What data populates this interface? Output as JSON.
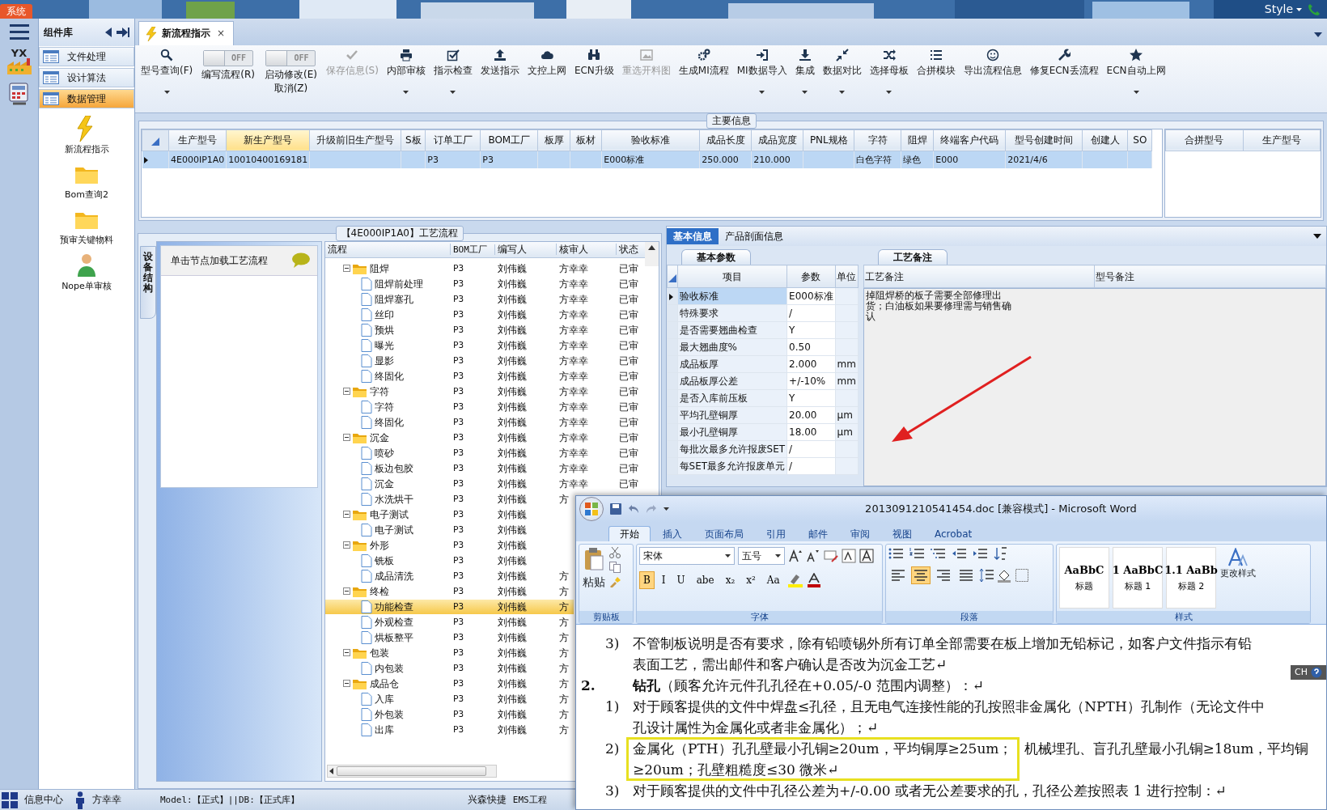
{
  "system_tab": "系统",
  "style_menu": "Style",
  "logo_text": "YX",
  "sidebar": {
    "title": "组件库",
    "categories": [
      {
        "label": "文件处理",
        "selected": false
      },
      {
        "label": "设计算法",
        "selected": false
      },
      {
        "label": "数据管理",
        "selected": true
      }
    ],
    "items": [
      {
        "label": "新流程指示"
      },
      {
        "label": "Bom查询2"
      },
      {
        "label": "预审关键物料"
      },
      {
        "label": "Nope单审核"
      }
    ]
  },
  "document_tab": {
    "label": "新流程指示",
    "close": "×"
  },
  "toolbar": [
    {
      "kind": "button",
      "label": "型号查询(F)",
      "disabled": false,
      "dropdown": true
    },
    {
      "kind": "toggle",
      "label": "编写流程(R)",
      "switch_text": "OFF",
      "on": false
    },
    {
      "kind": "toggle",
      "label": "启动修改(E)",
      "sublabel": "取消(Z)",
      "switch_text": "OFF",
      "on": false
    },
    {
      "kind": "button",
      "label": "保存信息(S)",
      "disabled": true,
      "dropdown": false
    },
    {
      "kind": "button",
      "label": "内部审核",
      "disabled": false,
      "dropdown": true
    },
    {
      "kind": "button",
      "label": "指示检查",
      "disabled": false,
      "dropdown": true
    },
    {
      "kind": "button",
      "label": "发送指示",
      "disabled": false,
      "dropdown": false
    },
    {
      "kind": "button",
      "label": "文控上网",
      "disabled": false,
      "dropdown": false
    },
    {
      "kind": "button",
      "label": "ECN升级",
      "disabled": false,
      "dropdown": false
    },
    {
      "kind": "button",
      "label": "重选开料图",
      "disabled": true,
      "dropdown": false
    },
    {
      "kind": "button",
      "label": "生成MI流程",
      "disabled": false,
      "dropdown": false
    },
    {
      "kind": "button",
      "label": "MI数据导入",
      "disabled": false,
      "dropdown": true
    },
    {
      "kind": "button",
      "label": "集成",
      "disabled": false,
      "dropdown": true
    },
    {
      "kind": "button",
      "label": "数据对比",
      "disabled": false,
      "dropdown": true
    },
    {
      "kind": "button",
      "label": "选择母板",
      "disabled": false,
      "dropdown": true
    },
    {
      "kind": "button",
      "label": "合拼模块",
      "disabled": false,
      "dropdown": false
    },
    {
      "kind": "button",
      "label": "导出流程信息",
      "disabled": false,
      "dropdown": false
    },
    {
      "kind": "button",
      "label": "修复ECN丢流程",
      "disabled": false,
      "dropdown": false
    },
    {
      "kind": "button",
      "label": "ECN自动上网",
      "disabled": false,
      "dropdown": true
    }
  ],
  "main_info": {
    "title": "主要信息",
    "columns": [
      {
        "label": "生产型号",
        "highlighted": false
      },
      {
        "label": "新生产型号",
        "highlighted": true
      },
      {
        "label": "升级前旧生产型号",
        "highlighted": false
      },
      {
        "label": "S板",
        "highlighted": false
      },
      {
        "label": "订单工厂",
        "highlighted": false
      },
      {
        "label": "BOM工厂",
        "highlighted": false
      },
      {
        "label": "板厚",
        "highlighted": false
      },
      {
        "label": "板材",
        "highlighted": false
      },
      {
        "label": "验收标准",
        "highlighted": false
      },
      {
        "label": "成品长度",
        "highlighted": false
      },
      {
        "label": "成品宽度",
        "highlighted": false
      },
      {
        "label": "PNL规格",
        "highlighted": false
      },
      {
        "label": "字符",
        "highlighted": false
      },
      {
        "label": "阻焊",
        "highlighted": false
      },
      {
        "label": "终端客户代码",
        "highlighted": false
      },
      {
        "label": "型号创建时间",
        "highlighted": false
      },
      {
        "label": "创建人",
        "highlighted": false
      },
      {
        "label": "SO",
        "highlighted": false
      }
    ],
    "rows": [
      {
        "selected": true,
        "cells": [
          "4E000IP1A0",
          "10010400169181",
          null,
          null,
          "P3",
          "P3",
          null,
          null,
          "E000标准",
          "250.000",
          "210.000",
          null,
          "白色字符",
          "绿色",
          "E000",
          "2021/4/6",
          null,
          null
        ]
      }
    ],
    "side_columns": [
      "合拼型号",
      "生产型号"
    ]
  },
  "process": {
    "title": "【4E000IP1A0】工艺流程",
    "side_tab": "设备结构",
    "hint": "单击节点加载工艺流程",
    "columns": [
      "流程",
      "BOM工厂",
      "编写人",
      "核审人",
      "状态"
    ],
    "tree": [
      {
        "name": "阻焊",
        "bom": "P3",
        "writer": "刘伟巍",
        "reviewer": "方幸幸",
        "status": "已审",
        "expanded": true,
        "selected": false,
        "children": [
          {
            "name": "阻焊前处理",
            "bom": "P3",
            "writer": "刘伟巍",
            "reviewer": "方幸幸",
            "status": "已审",
            "selected": false
          },
          {
            "name": "阻焊塞孔",
            "bom": "P3",
            "writer": "刘伟巍",
            "reviewer": "方幸幸",
            "status": "已审",
            "selected": false
          },
          {
            "name": "丝印",
            "bom": "P3",
            "writer": "刘伟巍",
            "reviewer": "方幸幸",
            "status": "已审",
            "selected": false
          },
          {
            "name": "预烘",
            "bom": "P3",
            "writer": "刘伟巍",
            "reviewer": "方幸幸",
            "status": "已审",
            "selected": false
          },
          {
            "name": "曝光",
            "bom": "P3",
            "writer": "刘伟巍",
            "reviewer": "方幸幸",
            "status": "已审",
            "selected": false
          },
          {
            "name": "显影",
            "bom": "P3",
            "writer": "刘伟巍",
            "reviewer": "方幸幸",
            "status": "已审",
            "selected": false
          },
          {
            "name": "终固化",
            "bom": "P3",
            "writer": "刘伟巍",
            "reviewer": "方幸幸",
            "status": "已审",
            "selected": false
          }
        ]
      },
      {
        "name": "字符",
        "bom": "P3",
        "writer": "刘伟巍",
        "reviewer": "方幸幸",
        "status": "已审",
        "expanded": true,
        "selected": false,
        "children": [
          {
            "name": "字符",
            "bom": "P3",
            "writer": "刘伟巍",
            "reviewer": "方幸幸",
            "status": "已审",
            "selected": false
          },
          {
            "name": "终固化",
            "bom": "P3",
            "writer": "刘伟巍",
            "reviewer": "方幸幸",
            "status": "已审",
            "selected": false
          }
        ]
      },
      {
        "name": "沉金",
        "bom": "P3",
        "writer": "刘伟巍",
        "reviewer": "方幸幸",
        "status": "已审",
        "expanded": true,
        "selected": false,
        "children": [
          {
            "name": "喷砂",
            "bom": "P3",
            "writer": "刘伟巍",
            "reviewer": "方幸幸",
            "status": "已审",
            "selected": false
          },
          {
            "name": "板边包胶",
            "bom": "P3",
            "writer": "刘伟巍",
            "reviewer": "方幸幸",
            "status": "已审",
            "selected": false
          },
          {
            "name": "沉金",
            "bom": "P3",
            "writer": "刘伟巍",
            "reviewer": "方幸幸",
            "status": "已审",
            "selected": false
          },
          {
            "name": "水洗烘干",
            "bom": "P3",
            "writer": "刘伟巍",
            "reviewer": "方",
            "selected": false
          }
        ]
      },
      {
        "name": "电子测试",
        "bom": "P3",
        "writer": "刘伟巍",
        "expanded": true,
        "selected": false,
        "children": [
          {
            "name": "电子测试",
            "bom": "P3",
            "writer": "刘伟巍",
            "selected": false
          }
        ]
      },
      {
        "name": "外形",
        "bom": "P3",
        "writer": "刘伟巍",
        "expanded": true,
        "selected": false,
        "children": [
          {
            "name": "铣板",
            "bom": "P3",
            "writer": "刘伟巍",
            "selected": false
          },
          {
            "name": "成品清洗",
            "bom": "P3",
            "writer": "刘伟巍",
            "reviewer": "方",
            "selected": false
          }
        ]
      },
      {
        "name": "终检",
        "bom": "P3",
        "writer": "刘伟巍",
        "reviewer": "方",
        "expanded": true,
        "selected": false,
        "children": [
          {
            "name": "功能检查",
            "bom": "P3",
            "writer": "刘伟巍",
            "reviewer": "方",
            "selected": true
          },
          {
            "name": "外观检查",
            "bom": "P3",
            "writer": "刘伟巍",
            "reviewer": "方",
            "selected": false
          },
          {
            "name": "烘板整平",
            "bom": "P3",
            "writer": "刘伟巍",
            "reviewer": "方",
            "selected": false
          }
        ]
      },
      {
        "name": "包装",
        "bom": "P3",
        "writer": "刘伟巍",
        "reviewer": "方",
        "expanded": true,
        "selected": false,
        "children": [
          {
            "name": "内包装",
            "bom": "P3",
            "writer": "刘伟巍",
            "reviewer": "方",
            "selected": false
          }
        ]
      },
      {
        "name": "成品仓",
        "bom": "P3",
        "writer": "刘伟巍",
        "reviewer": "方",
        "expanded": true,
        "selected": false,
        "children": [
          {
            "name": "入库",
            "bom": "P3",
            "writer": "刘伟巍",
            "reviewer": "方",
            "selected": false
          },
          {
            "name": "外包装",
            "bom": "P3",
            "writer": "刘伟巍",
            "reviewer": "方",
            "selected": false
          },
          {
            "name": "出库",
            "bom": "P3",
            "writer": "刘伟巍",
            "reviewer": "方",
            "selected": false
          }
        ]
      }
    ]
  },
  "info_panel": {
    "tabs": [
      {
        "label": "基本信息",
        "selected": true
      },
      {
        "label": "产品剖面信息",
        "selected": false
      }
    ],
    "params": {
      "tab": "基本参数",
      "columns": [
        "项目",
        "参数",
        "单位"
      ],
      "rows": [
        {
          "item": "验收标准",
          "value": "E000标准",
          "selected": true
        },
        {
          "item": "特殊要求",
          "value": "/",
          "selected": false
        },
        {
          "item": "是否需要翘曲检查",
          "value": "Y",
          "selected": false
        },
        {
          "item": "最大翘曲度%",
          "value": "0.50",
          "selected": false
        },
        {
          "item": "成品板厚",
          "value": "2.000",
          "unit": "mm",
          "selected": false
        },
        {
          "item": "成品板厚公差",
          "value": "+/-10%",
          "unit": "mm",
          "selected": false
        },
        {
          "item": "是否入库前压板",
          "value": "Y",
          "selected": false
        },
        {
          "item": "平均孔壁铜厚",
          "value": "20.00",
          "unit": "μm",
          "selected": false
        },
        {
          "item": "最小孔壁铜厚",
          "value": "18.00",
          "unit": "μm",
          "selected": false
        },
        {
          "item": "每批次最多允许报废SET",
          "value": "/",
          "selected": false
        },
        {
          "item": "每SET最多允许报废单元",
          "value": "/",
          "selected": false
        }
      ]
    },
    "notes": {
      "tab": "工艺备注",
      "columns": [
        "工艺备注",
        "型号备注"
      ],
      "process_note": "掉阻焊桥的板子需要全部修理出货；白油板如果要修理需与销售确认"
    }
  },
  "word": {
    "title": "2013091210541454.doc [兼容模式] - Microsoft Word",
    "tabs": [
      {
        "label": "开始",
        "selected": true
      },
      {
        "label": "插入",
        "selected": false
      },
      {
        "label": "页面布局",
        "selected": false
      },
      {
        "label": "引用",
        "selected": false
      },
      {
        "label": "邮件",
        "selected": false
      },
      {
        "label": "审阅",
        "selected": false
      },
      {
        "label": "视图",
        "selected": false
      },
      {
        "label": "Acrobat",
        "selected": false
      }
    ],
    "paste": "粘贴",
    "font_name": "宋体",
    "font_size": "五号",
    "font_buttons": [
      {
        "label": "B",
        "selected": true
      },
      {
        "label": "I",
        "selected": false
      },
      {
        "label": "U",
        "selected": false
      },
      {
        "label": "abe",
        "selected": false
      },
      {
        "label": "x₂",
        "selected": false
      },
      {
        "label": "x²",
        "selected": false
      },
      {
        "label": "Aa",
        "selected": false
      }
    ],
    "align_buttons": [
      {
        "selected": false
      },
      {
        "selected": true
      },
      {
        "selected": false
      },
      {
        "selected": false
      }
    ],
    "styles": [
      {
        "preview": "AaBbC",
        "label": "标题"
      },
      {
        "preview": "1 AaBbC",
        "label": "标题 1"
      },
      {
        "preview": "1.1 AaBb",
        "label": "标题 2"
      }
    ],
    "change_styles": "更改样式",
    "groups": [
      "剪贴板",
      "字体",
      "段落",
      "样式"
    ],
    "language_bar": "CH",
    "lines": [
      {
        "kind": "item",
        "marker": "3)",
        "text": "不管制板说明是否有要求，除有铅喷锡外所有订单全部需要在板上增加无铅标记，如客户文件指示有铅"
      },
      {
        "kind": "cont",
        "text": "表面工艺，需出邮件和客户确认是否改为沉金工艺↵"
      },
      {
        "kind": "heading",
        "marker": "2.",
        "text": "**钻孔**（顾客允许元件孔孔径在+0.05/-0 范围内调整）：↵"
      },
      {
        "kind": "item",
        "marker": "1)",
        "text": "对于顾客提供的文件中焊盘≤孔径，且无电气连接性能的孔按照非金属化（NPTH）孔制作（无论文件中"
      },
      {
        "kind": "cont",
        "text": "孔设计属性为金属化或者非金属化）；↵"
      },
      {
        "kind": "item",
        "marker": "2)",
        "highlight": "金属化（PTH）孔孔壁最小孔铜≥20um，平均铜厚≥25um；",
        "text": "机械埋孔、盲孔孔壁最小孔铜≥18um，平均铜"
      },
      {
        "kind": "cont",
        "highlight": "≥20um；孔壁粗糙度≤30 微米↵"
      },
      {
        "kind": "item",
        "marker": "3)",
        "text": "对于顾客提供的文件中孔径公差为+/-0.00 或者无公差要求的孔，孔径公差按照表 1 进行控制：↵"
      }
    ]
  },
  "status_bar": {
    "items": [
      "信息中心",
      "方幸幸"
    ],
    "model": "Model:【正式】||DB:【正式库】",
    "company": "兴森快捷",
    "system": "EMS工程"
  }
}
